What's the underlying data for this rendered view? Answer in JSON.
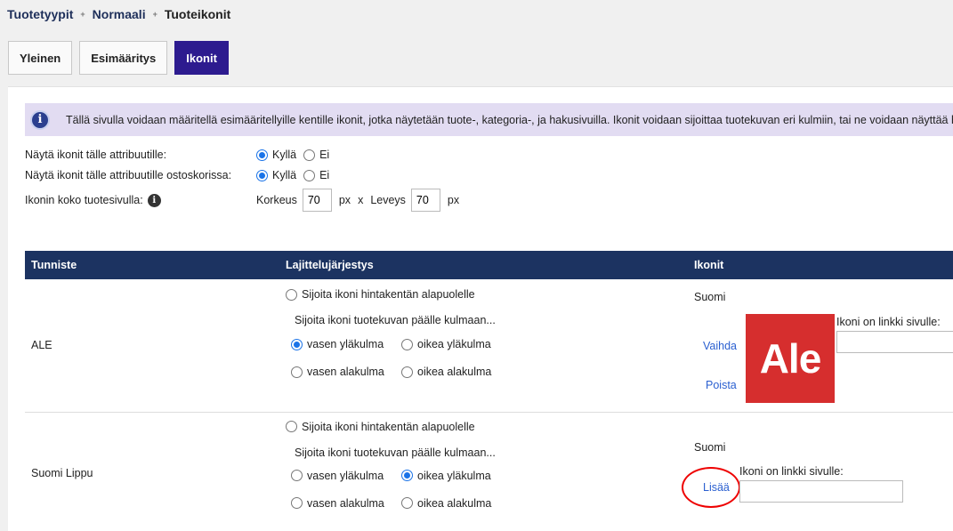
{
  "breadcrumb": {
    "items": [
      "Tuotetyypit",
      "Normaali"
    ],
    "separator": "+",
    "current": "Tuoteikonit"
  },
  "tabs": [
    {
      "label": "Yleinen",
      "active": false
    },
    {
      "label": "Esimääritys",
      "active": false
    },
    {
      "label": "Ikonit",
      "active": true
    }
  ],
  "info": {
    "icon": "info-icon",
    "text": "Tällä sivulla voidaan määritellä esimääritellyille kentille ikonit, jotka näytetään tuote-, kategoria-, ja hakusivuilla. Ikonit voidaan sijoittaa tuotekuvan eri kulmiin, tai ne voidaan näyttää hintakentän alapuolella."
  },
  "settings": {
    "show_icons": {
      "label": "Näytä ikonit tälle attribuutille:",
      "options": [
        "Kyllä",
        "Ei"
      ],
      "selected": "Kyllä"
    },
    "show_in_cart": {
      "label": "Näytä ikonit tälle attribuutille ostoskorissa:",
      "options": [
        "Kyllä",
        "Ei"
      ],
      "selected": "Kyllä"
    },
    "icon_size": {
      "label": "Ikonin koko tuotesivulla:",
      "height_label": "Korkeus",
      "height_value": "70",
      "unit": "px",
      "times": "x",
      "width_label": "Leveys",
      "width_value": "70"
    }
  },
  "table": {
    "headers": [
      "Tunniste",
      "Lajittelujärjestys",
      "Ikonit"
    ],
    "place_below_price": "Sijoita ikoni hintakentän alapuolelle",
    "place_on_image": "Sijoita ikoni tuotekuvan päälle kulmaan...",
    "corners": [
      "vasen yläkulma",
      "oikea yläkulma",
      "vasen alakulma",
      "oikea alakulma"
    ],
    "language": "Suomi",
    "link_label": "Ikoni on linkki sivulle:",
    "rows": [
      {
        "id": "ALE",
        "selected_corner": "vasen yläkulma",
        "change_label": "Vaihda",
        "remove_label": "Poista",
        "icon_text": "Ale",
        "icon_color": "#d62e2e"
      },
      {
        "id": "Suomi Lippu",
        "selected_corner": "oikea yläkulma",
        "add_label": "Lisää"
      }
    ]
  },
  "colors": {
    "accent": "#2d1b8f",
    "header": "#1c3361",
    "info_bg": "#e2dcf2",
    "link": "#2a5fd0",
    "highlight": "#e00000"
  }
}
